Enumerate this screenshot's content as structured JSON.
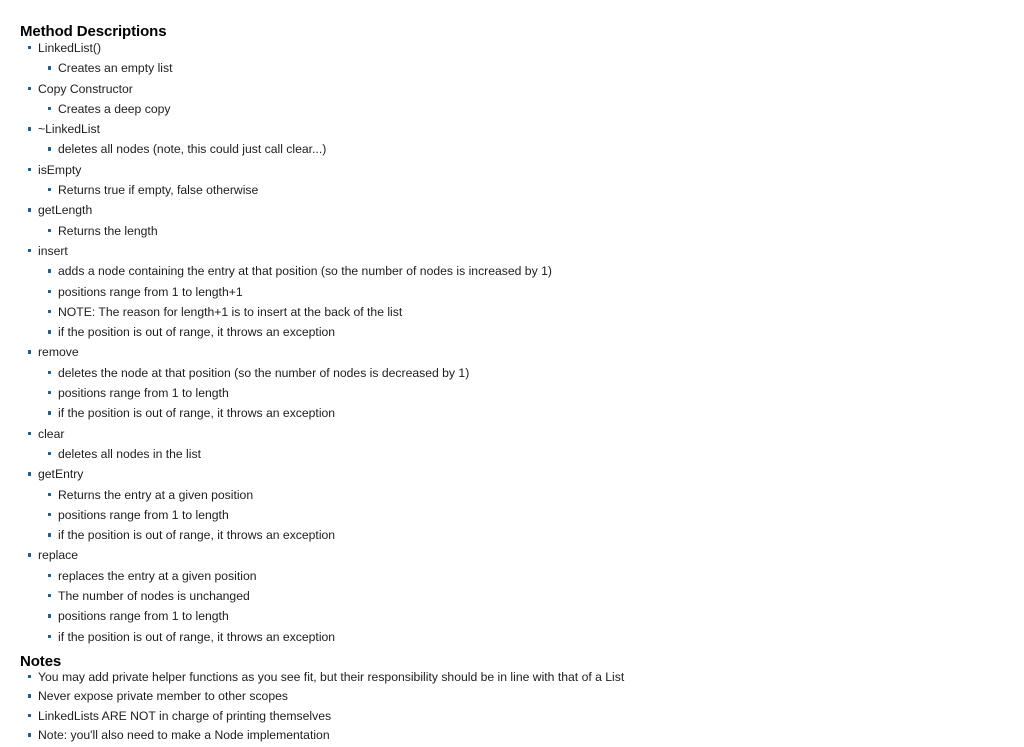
{
  "document": {
    "bullet_color": "#1c5e92",
    "text_color": "#1d1d1d",
    "background_color": "#ffffff"
  },
  "methods_section": {
    "heading": "Method Descriptions",
    "items": [
      {
        "level": 1,
        "text": "LinkedList()"
      },
      {
        "level": 2,
        "text": "Creates an empty list"
      },
      {
        "level": 1,
        "text": "Copy Constructor"
      },
      {
        "level": 2,
        "text": "Creates a deep copy"
      },
      {
        "level": 1,
        "text": "~LinkedList"
      },
      {
        "level": 2,
        "text": "deletes all nodes (note, this could just call clear...)"
      },
      {
        "level": 1,
        "text": "isEmpty"
      },
      {
        "level": 2,
        "text": "Returns true if empty, false otherwise"
      },
      {
        "level": 1,
        "text": "getLength"
      },
      {
        "level": 2,
        "text": "Returns the length"
      },
      {
        "level": 1,
        "text": "insert"
      },
      {
        "level": 2,
        "text": "adds a node containing the entry at that position (so the number of nodes is increased by 1)"
      },
      {
        "level": 2,
        "text": "positions range from 1 to length+1"
      },
      {
        "level": 2,
        "text": "NOTE: The reason for length+1 is to insert at the back of the list"
      },
      {
        "level": 2,
        "text": "if the position is out of range, it throws an exception"
      },
      {
        "level": 1,
        "text": "remove"
      },
      {
        "level": 2,
        "text": "deletes the node at that position (so the number of nodes is decreased by 1)"
      },
      {
        "level": 2,
        "text": "positions range from 1 to length"
      },
      {
        "level": 2,
        "text": "if the position is out of range, it throws an exception"
      },
      {
        "level": 1,
        "text": "clear"
      },
      {
        "level": 2,
        "text": "deletes all nodes in the list"
      },
      {
        "level": 1,
        "text": "getEntry"
      },
      {
        "level": 2,
        "text": "Returns the entry at a given position"
      },
      {
        "level": 2,
        "text": "positions range from 1 to length"
      },
      {
        "level": 2,
        "text": "if the position is out of range, it throws an exception"
      },
      {
        "level": 1,
        "text": "replace"
      },
      {
        "level": 2,
        "text": "replaces the entry at a given position"
      },
      {
        "level": 2,
        "text": "The number of nodes is unchanged"
      },
      {
        "level": 2,
        "text": "positions range from 1 to length"
      },
      {
        "level": 2,
        "text": "if the position is out of range, it throws an exception"
      }
    ]
  },
  "notes_section": {
    "heading": "Notes",
    "items": [
      {
        "level": 1,
        "text": "You may add private helper functions as you see fit, but their responsibility should be in line with that of a List"
      },
      {
        "level": 1,
        "text": "Never expose private member to other scopes"
      },
      {
        "level": 1,
        "text": "LinkedLists ARE NOT in charge of printing themselves"
      },
      {
        "level": 1,
        "text": "Note: you'll also need to make a Node implementation"
      }
    ]
  }
}
